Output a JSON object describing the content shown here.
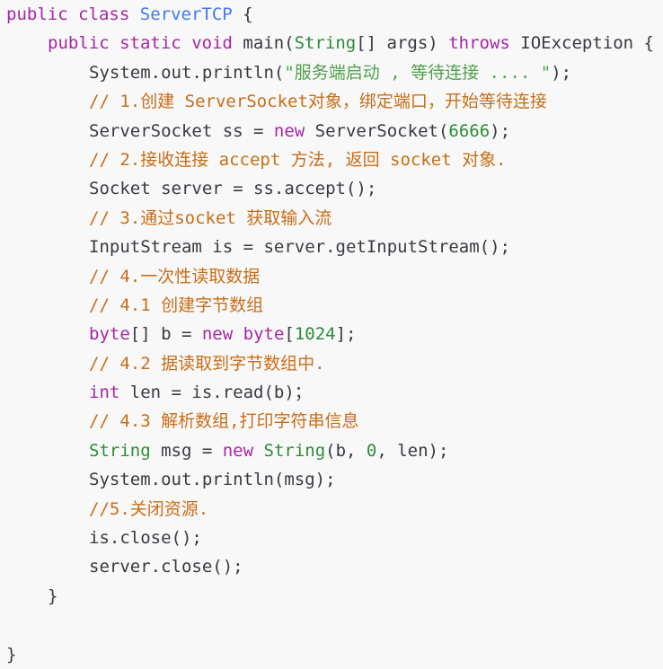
{
  "colors": {
    "background": "#f8f8f8",
    "keyword": "#a626a4",
    "plain": "#383a42",
    "type": "#2f8a3a",
    "class_name": "#4078f2",
    "string": "#50a14f",
    "number": "#2f8a3a",
    "comment": "#c76e18"
  },
  "code": {
    "language": "java",
    "lines": [
      {
        "indent": 0,
        "tokens": [
          {
            "t": "kw",
            "v": "public"
          },
          {
            "t": "plain",
            "v": " "
          },
          {
            "t": "kw",
            "v": "class"
          },
          {
            "t": "plain",
            "v": " "
          },
          {
            "t": "class",
            "v": "ServerTCP"
          },
          {
            "t": "plain",
            "v": " {"
          }
        ]
      },
      {
        "indent": 1,
        "tokens": [
          {
            "t": "kw",
            "v": "public"
          },
          {
            "t": "plain",
            "v": " "
          },
          {
            "t": "kw",
            "v": "static"
          },
          {
            "t": "plain",
            "v": " "
          },
          {
            "t": "kw",
            "v": "void"
          },
          {
            "t": "plain",
            "v": " main("
          },
          {
            "t": "type",
            "v": "String"
          },
          {
            "t": "plain",
            "v": "[] args) "
          },
          {
            "t": "kw",
            "v": "throws"
          },
          {
            "t": "plain",
            "v": " IOException {"
          }
        ]
      },
      {
        "indent": 2,
        "tokens": [
          {
            "t": "plain",
            "v": "System.out.println("
          },
          {
            "t": "str",
            "v": "\"服务端启动 , 等待连接 .... \""
          },
          {
            "t": "plain",
            "v": ");"
          }
        ]
      },
      {
        "indent": 2,
        "tokens": [
          {
            "t": "comment",
            "v": "// 1.创建 ServerSocket对象，绑定端口，开始等待连接"
          }
        ]
      },
      {
        "indent": 2,
        "tokens": [
          {
            "t": "plain",
            "v": "ServerSocket ss = "
          },
          {
            "t": "kw",
            "v": "new"
          },
          {
            "t": "plain",
            "v": " ServerSocket("
          },
          {
            "t": "num",
            "v": "6666"
          },
          {
            "t": "plain",
            "v": ");"
          }
        ]
      },
      {
        "indent": 2,
        "tokens": [
          {
            "t": "comment",
            "v": "// 2.接收连接 accept 方法, 返回 socket 对象."
          }
        ]
      },
      {
        "indent": 2,
        "tokens": [
          {
            "t": "plain",
            "v": "Socket server = ss.accept();"
          }
        ]
      },
      {
        "indent": 2,
        "tokens": [
          {
            "t": "comment",
            "v": "// 3.通过socket 获取输入流"
          }
        ]
      },
      {
        "indent": 2,
        "tokens": [
          {
            "t": "plain",
            "v": "InputStream is = server.getInputStream();"
          }
        ]
      },
      {
        "indent": 2,
        "tokens": [
          {
            "t": "comment",
            "v": "// 4.一次性读取数据"
          }
        ]
      },
      {
        "indent": 2,
        "tokens": [
          {
            "t": "comment",
            "v": "// 4.1 创建字节数组"
          }
        ]
      },
      {
        "indent": 2,
        "tokens": [
          {
            "t": "kw",
            "v": "byte"
          },
          {
            "t": "plain",
            "v": "[] b = "
          },
          {
            "t": "kw",
            "v": "new"
          },
          {
            "t": "plain",
            "v": " "
          },
          {
            "t": "kw",
            "v": "byte"
          },
          {
            "t": "plain",
            "v": "["
          },
          {
            "t": "num",
            "v": "1024"
          },
          {
            "t": "plain",
            "v": "];"
          }
        ]
      },
      {
        "indent": 2,
        "tokens": [
          {
            "t": "comment",
            "v": "// 4.2 据读取到字节数组中."
          }
        ]
      },
      {
        "indent": 2,
        "tokens": [
          {
            "t": "kw",
            "v": "int"
          },
          {
            "t": "plain",
            "v": " len = is.read(b)；"
          }
        ]
      },
      {
        "indent": 2,
        "tokens": [
          {
            "t": "comment",
            "v": "// 4.3 解析数组,打印字符串信息"
          }
        ]
      },
      {
        "indent": 2,
        "tokens": [
          {
            "t": "type",
            "v": "String"
          },
          {
            "t": "plain",
            "v": " msg = "
          },
          {
            "t": "kw",
            "v": "new"
          },
          {
            "t": "plain",
            "v": " "
          },
          {
            "t": "type",
            "v": "String"
          },
          {
            "t": "plain",
            "v": "(b, "
          },
          {
            "t": "num",
            "v": "0"
          },
          {
            "t": "plain",
            "v": ", len);"
          }
        ]
      },
      {
        "indent": 2,
        "tokens": [
          {
            "t": "plain",
            "v": "System.out.println(msg);"
          }
        ]
      },
      {
        "indent": 2,
        "tokens": [
          {
            "t": "comment",
            "v": "//5.关闭资源."
          }
        ]
      },
      {
        "indent": 2,
        "tokens": [
          {
            "t": "plain",
            "v": "is.close();"
          }
        ]
      },
      {
        "indent": 2,
        "tokens": [
          {
            "t": "plain",
            "v": "server.close();"
          }
        ]
      },
      {
        "indent": 1,
        "tokens": [
          {
            "t": "plain",
            "v": "}"
          }
        ]
      },
      {
        "indent": 0,
        "tokens": []
      },
      {
        "indent": 0,
        "tokens": [
          {
            "t": "plain",
            "v": "}"
          }
        ]
      }
    ]
  }
}
